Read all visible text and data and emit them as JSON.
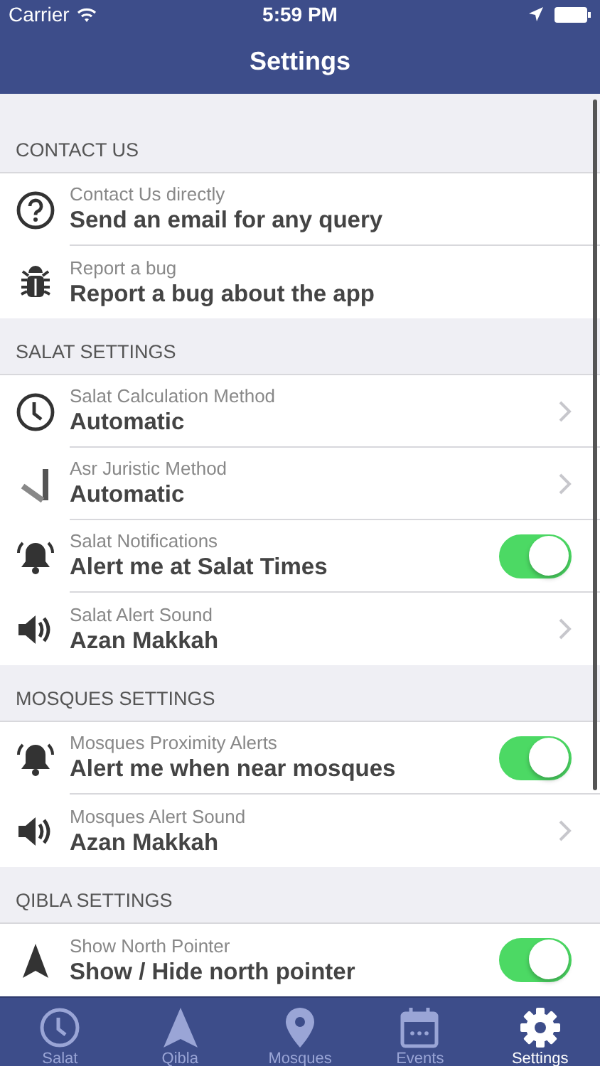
{
  "status_bar": {
    "carrier": "Carrier",
    "time": "5:59 PM"
  },
  "nav_bar": {
    "title": "Settings"
  },
  "sections": [
    {
      "header": "CONTACT US",
      "rows": [
        {
          "kind": "plain",
          "label": "Contact Us directly",
          "value": "Send an email for any query"
        },
        {
          "kind": "plain",
          "label": "Report a bug",
          "value": "Report a bug about the app"
        }
      ]
    },
    {
      "header": "SALAT SETTINGS",
      "rows": [
        {
          "kind": "nav",
          "label": "Salat Calculation Method",
          "value": "Automatic"
        },
        {
          "kind": "nav",
          "label": "Asr Juristic Method",
          "value": "Automatic"
        },
        {
          "kind": "toggle",
          "label": "Salat Notifications",
          "value": "Alert me at Salat Times",
          "on": true
        },
        {
          "kind": "nav",
          "label": "Salat Alert Sound",
          "value": "Azan Makkah"
        }
      ]
    },
    {
      "header": "MOSQUES SETTINGS",
      "rows": [
        {
          "kind": "toggle",
          "label": "Mosques Proximity Alerts",
          "value": "Alert me when near mosques",
          "on": true
        },
        {
          "kind": "nav",
          "label": "Mosques Alert Sound",
          "value": "Azan Makkah"
        }
      ]
    },
    {
      "header": "QIBLA SETTINGS",
      "rows": [
        {
          "kind": "toggle",
          "label": "Show North Pointer",
          "value": "Show / Hide north pointer",
          "on": true
        }
      ]
    }
  ],
  "tab_bar": [
    {
      "label": "Salat",
      "selected": false
    },
    {
      "label": "Qibla",
      "selected": false
    },
    {
      "label": "Mosques",
      "selected": false
    },
    {
      "label": "Events",
      "selected": false
    },
    {
      "label": "Settings",
      "selected": true
    }
  ]
}
